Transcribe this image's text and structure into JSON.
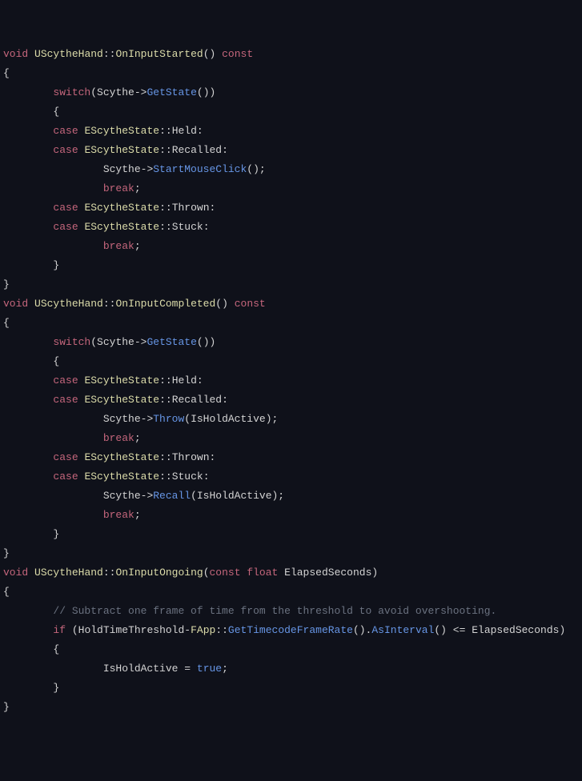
{
  "code": {
    "fn1": {
      "ret": "void",
      "cls": "UScytheHand",
      "name": "OnInputStarted",
      "qual": "const",
      "switch_kw": "switch",
      "switch_expr_obj": "Scythe",
      "switch_expr_fn": "GetState",
      "case_kw": "case",
      "enum_type": "EScytheState",
      "c1": "Held",
      "c2": "Recalled",
      "stmt1_obj": "Scythe",
      "stmt1_fn": "StartMouseClick",
      "break_kw": "break",
      "c3": "Thrown",
      "c4": "Stuck"
    },
    "fn2": {
      "ret": "void",
      "cls": "UScytheHand",
      "name": "OnInputCompleted",
      "qual": "const",
      "switch_kw": "switch",
      "switch_expr_obj": "Scythe",
      "switch_expr_fn": "GetState",
      "case_kw": "case",
      "enum_type": "EScytheState",
      "c1": "Held",
      "c2": "Recalled",
      "stmt1_obj": "Scythe",
      "stmt1_fn": "Throw",
      "stmt1_arg": "IsHoldActive",
      "break_kw": "break",
      "c3": "Thrown",
      "c4": "Stuck",
      "stmt2_obj": "Scythe",
      "stmt2_fn": "Recall",
      "stmt2_arg": "IsHoldActive"
    },
    "fn3": {
      "ret": "void",
      "cls": "UScytheHand",
      "name": "OnInputOngoing",
      "param_qual": "const",
      "param_type": "float",
      "param_name": "ElapsedSeconds",
      "comment": "// Subtract one frame of time from the threshold to avoid overshooting.",
      "if_kw": "if",
      "var1": "HoldTimeThreshold",
      "cls2": "FApp",
      "fn_call": "GetTimecodeFrameRate",
      "method": "AsInterval",
      "op": "<=",
      "rhs": "ElapsedSeconds",
      "assign_lhs": "IsHoldActive",
      "assign_rhs": "true"
    }
  }
}
